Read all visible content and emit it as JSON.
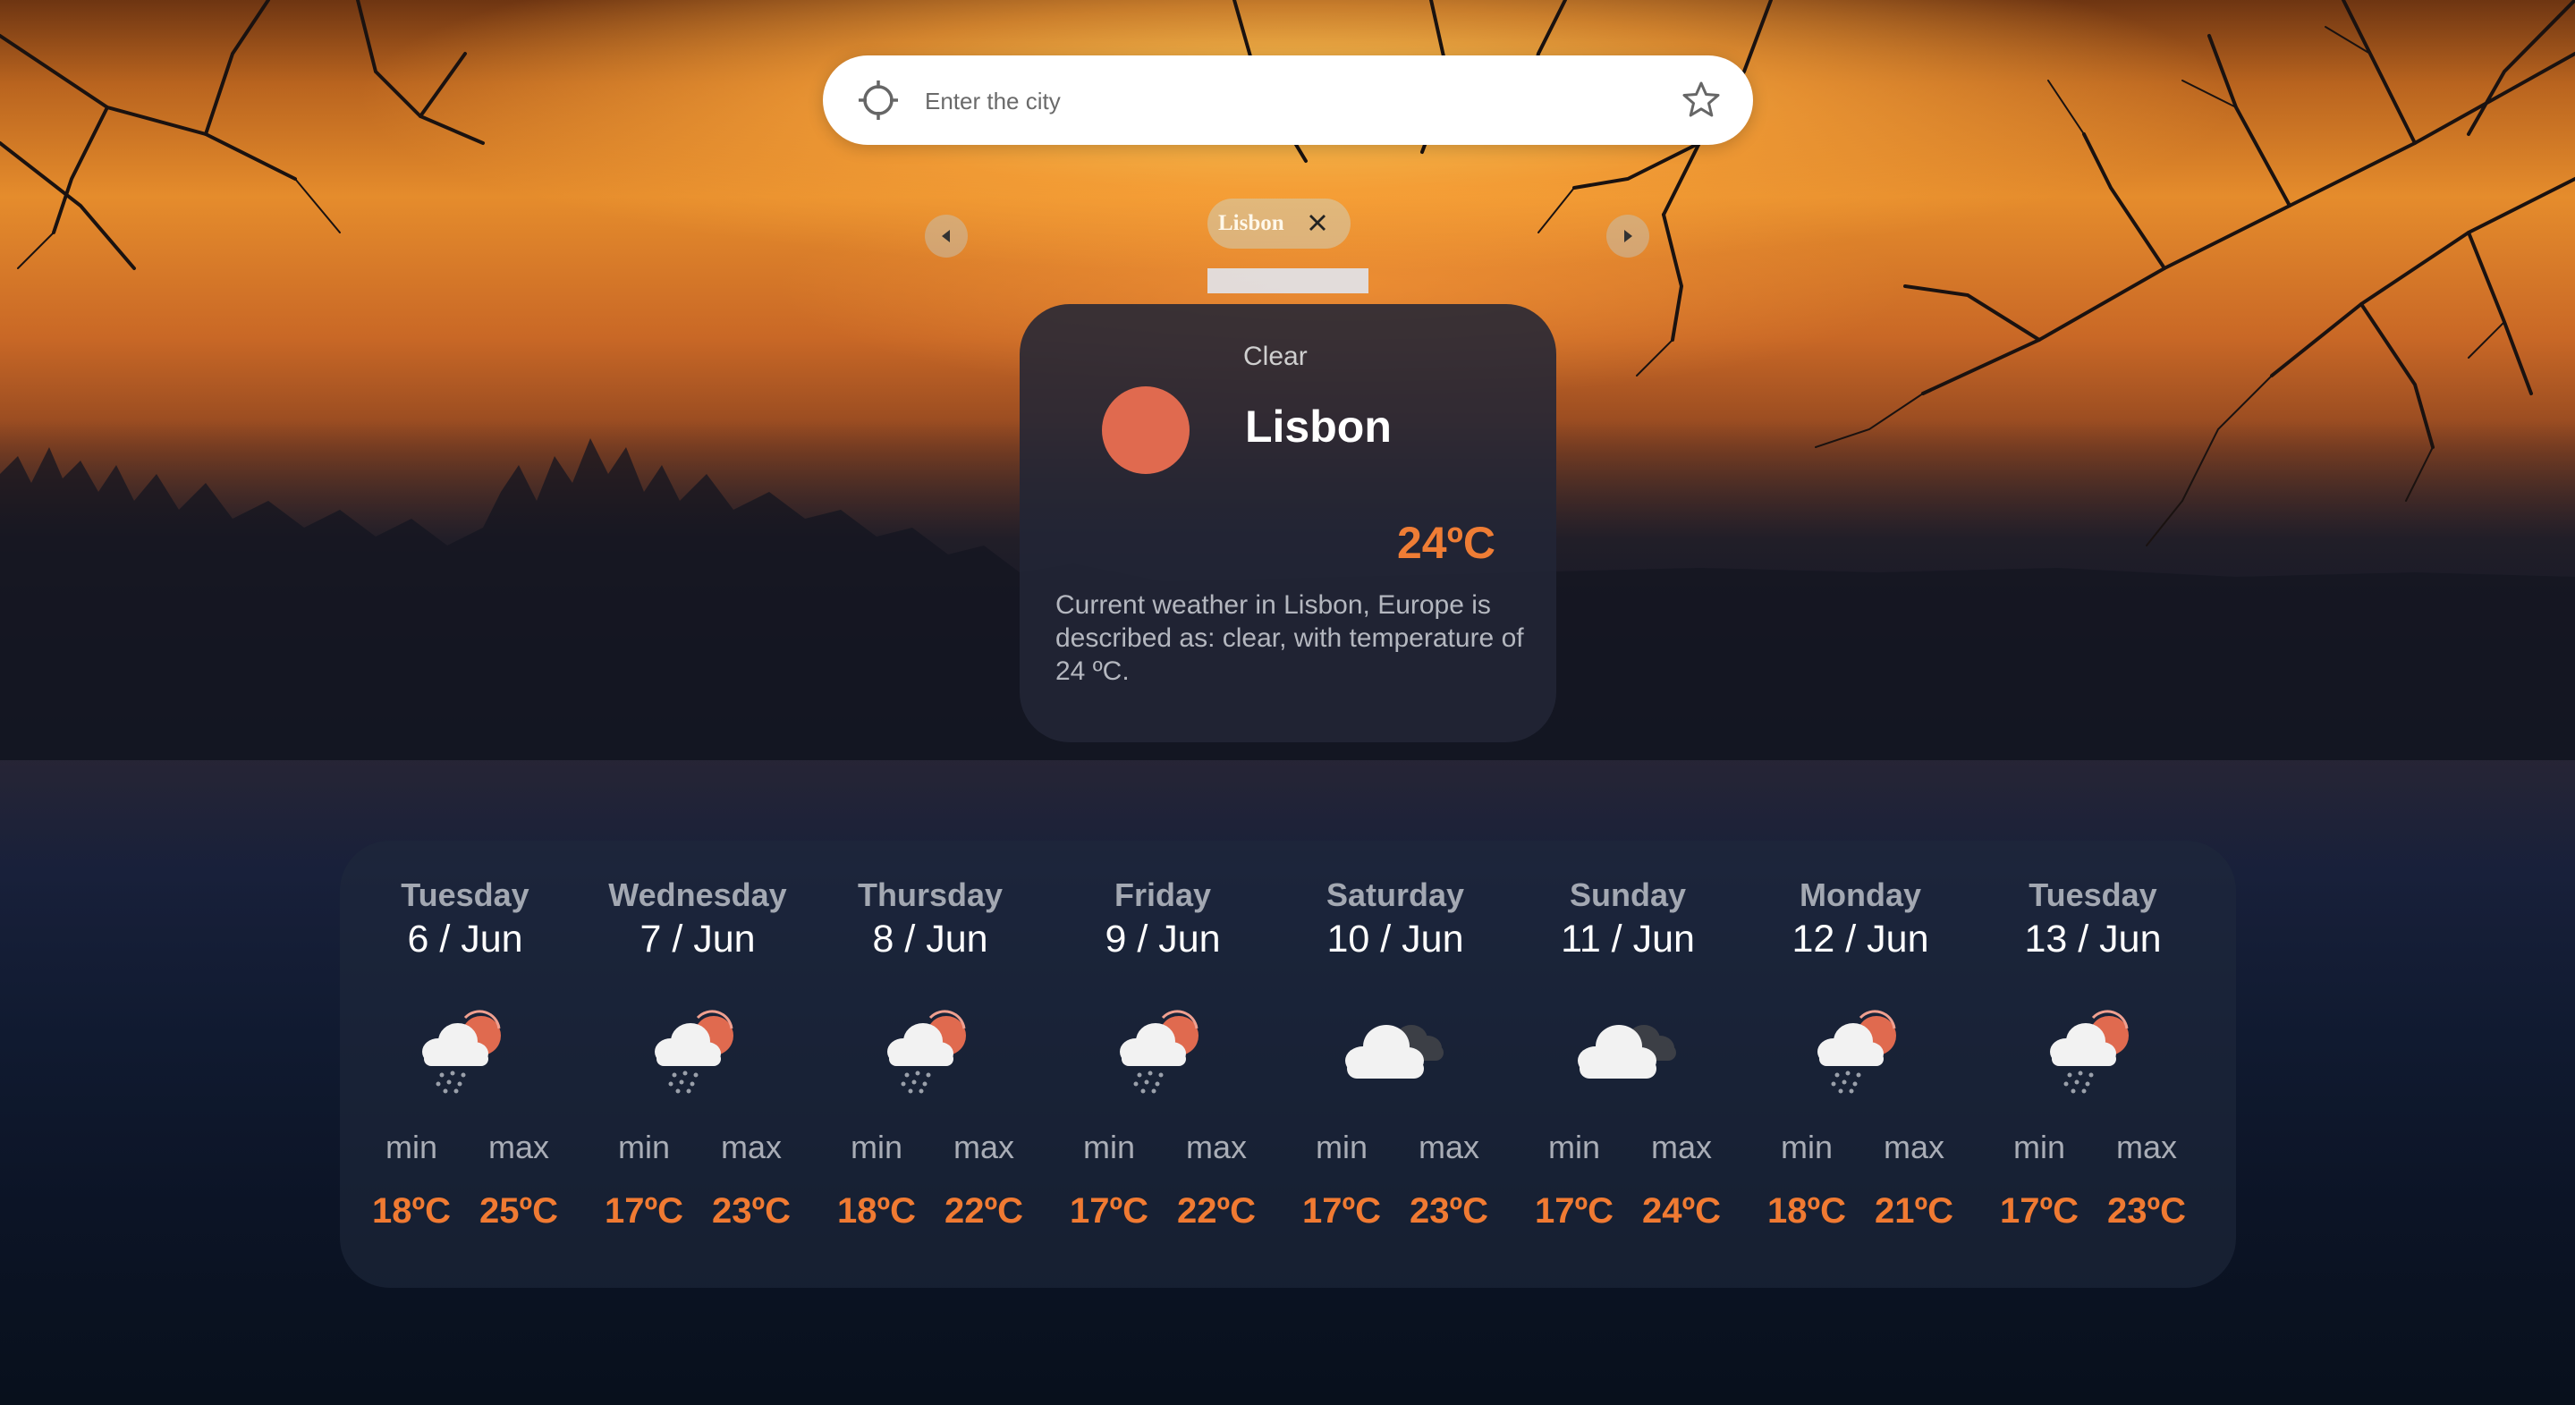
{
  "search": {
    "placeholder": "Enter the city",
    "locate_icon": "crosshair-icon",
    "favorite_icon": "star-icon"
  },
  "saved_cities": [
    {
      "label": "Lisbon",
      "close_icon": "close-icon"
    }
  ],
  "current": {
    "condition": "Clear",
    "city": "Lisbon",
    "temperature": "24ºC",
    "description": "Current weather in Lisbon, Europe is described as: clear, with temperature of 24 ºC.",
    "icon": "sun-icon",
    "icon_color": "#e06a4f"
  },
  "forecast_labels": {
    "min": "min",
    "max": "max"
  },
  "forecast": [
    {
      "day": "Tuesday",
      "date": "6 / Jun",
      "icon": "rain-cloud-sun-icon",
      "min": "18ºC",
      "max": "25ºC"
    },
    {
      "day": "Wednesday",
      "date": "7 / Jun",
      "icon": "rain-cloud-sun-icon",
      "min": "17ºC",
      "max": "23ºC"
    },
    {
      "day": "Thursday",
      "date": "8 / Jun",
      "icon": "rain-cloud-sun-icon",
      "min": "18ºC",
      "max": "22ºC"
    },
    {
      "day": "Friday",
      "date": "9 / Jun",
      "icon": "rain-cloud-sun-icon",
      "min": "17ºC",
      "max": "22ºC"
    },
    {
      "day": "Saturday",
      "date": "10 / Jun",
      "icon": "cloudy-icon",
      "min": "17ºC",
      "max": "23ºC"
    },
    {
      "day": "Sunday",
      "date": "11 / Jun",
      "icon": "cloudy-icon",
      "min": "17ºC",
      "max": "24ºC"
    },
    {
      "day": "Monday",
      "date": "12 / Jun",
      "icon": "rain-cloud-sun-icon",
      "min": "18ºC",
      "max": "21ºC"
    },
    {
      "day": "Tuesday",
      "date": "13 / Jun",
      "icon": "rain-cloud-sun-icon",
      "min": "17ºC",
      "max": "23ºC"
    }
  ],
  "colors": {
    "accent": "#f07a32",
    "card_bg": "#222636"
  }
}
